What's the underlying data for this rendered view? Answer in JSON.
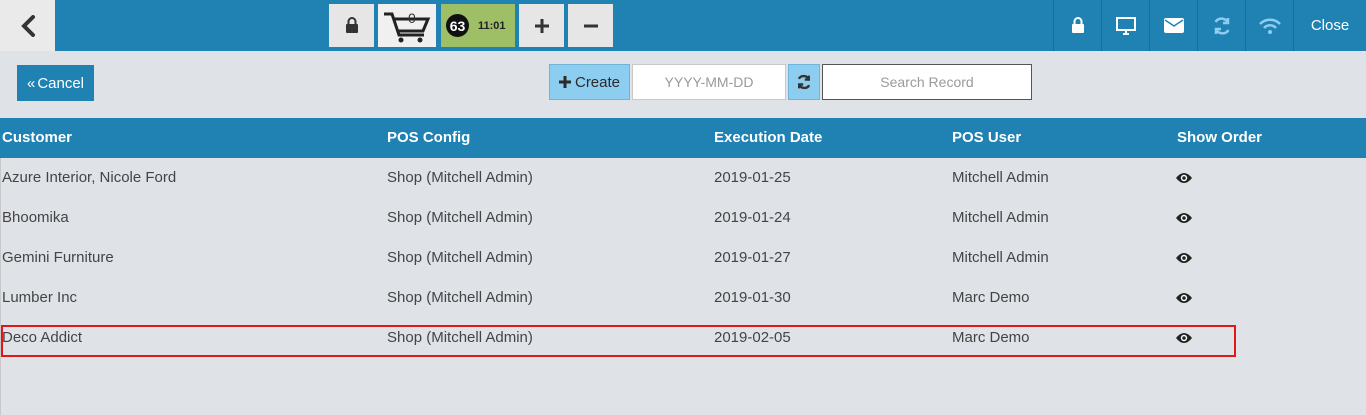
{
  "topbar": {
    "cart_count": "0",
    "timer_badge": "63",
    "timer_time": "11:01",
    "close_label": "Close",
    "icons": [
      "back-arrow",
      "lock",
      "cart",
      "plus",
      "minus",
      "lock",
      "monitor",
      "envelope",
      "sync",
      "wifi"
    ]
  },
  "actions": {
    "cancel_label": "Cancel",
    "create_label": "Create",
    "date_placeholder": "YYYY-MM-DD",
    "search_placeholder": "Search Record"
  },
  "table": {
    "headers": [
      "Customer",
      "POS Config",
      "Execution Date",
      "POS User",
      "Show Order"
    ],
    "rows": [
      [
        "Azure Interior, Nicole Ford",
        "Shop (Mitchell Admin)",
        "2019-01-25",
        "Mitchell Admin"
      ],
      [
        "Bhoomika",
        "Shop (Mitchell Admin)",
        "2019-01-24",
        "Mitchell Admin"
      ],
      [
        "Gemini Furniture",
        "Shop (Mitchell Admin)",
        "2019-01-27",
        "Mitchell Admin"
      ],
      [
        "Lumber Inc",
        "Shop (Mitchell Admin)",
        "2019-01-30",
        "Marc Demo"
      ],
      [
        "Deco Addict",
        "Shop (Mitchell Admin)",
        "2019-02-05",
        "Marc Demo"
      ]
    ]
  },
  "colors": {
    "primary": "#2081b3",
    "accent_light": "#8dcdf0",
    "timer_bg": "#9ebf66",
    "highlight": "#e01818"
  }
}
